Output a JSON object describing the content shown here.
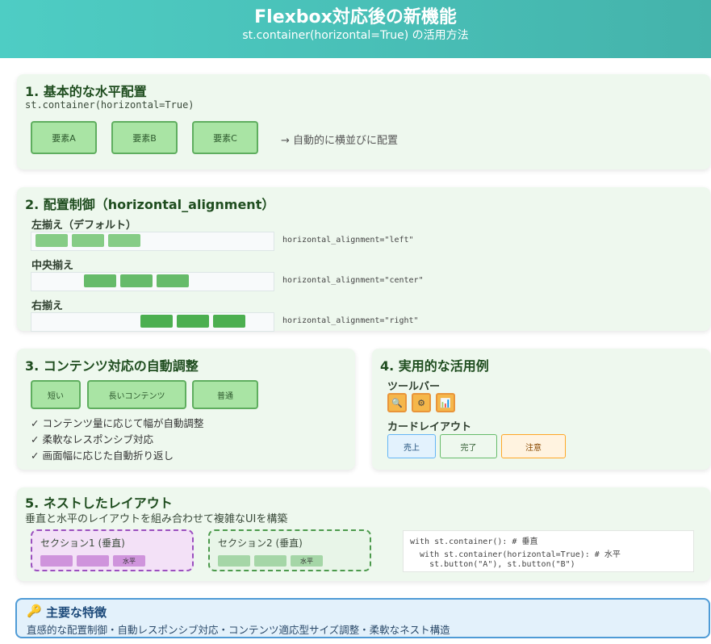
{
  "header": {
    "title": "Flexbox対応後の新機能",
    "subtitle": "st.container(horizontal=True) の活用方法"
  },
  "s1": {
    "title": "1. 基本的な水平配置",
    "code": "st.container(horizontal=True)",
    "boxes": [
      "要素A",
      "要素B",
      "要素C"
    ],
    "arrow_note": "→ 自動的に横並びに配置"
  },
  "s2": {
    "title": "2. 配置制御（horizontal_alignment）",
    "rows": [
      {
        "label": "左揃え（デフォルト）",
        "code": "horizontal_alignment=\"left\""
      },
      {
        "label": "中央揃え",
        "code": "horizontal_alignment=\"center\""
      },
      {
        "label": "右揃え",
        "code": "horizontal_alignment=\"right\""
      }
    ]
  },
  "s3": {
    "title": "3. コンテンツ対応の自動調整",
    "boxes": [
      "短い",
      "長いコンテンツ",
      "普通"
    ],
    "checks": [
      "✓ コンテンツ量に応じて幅が自動調整",
      "✓ 柔軟なレスポンシブ対応",
      "✓ 画面幅に応じた自動折り返し"
    ]
  },
  "s4": {
    "title": "4. 実用的な活用例",
    "toolbar_label": "ツールバー",
    "toolbar_icons": [
      "🔍",
      "⚙",
      "📊"
    ],
    "cards_label": "カードレイアウト",
    "cards": [
      "売上",
      "完了",
      "注意"
    ]
  },
  "s5": {
    "title": "5. ネストしたレイアウト",
    "desc": "垂直と水平のレイアウトを組み合わせて複雑なUIを構築",
    "sec1": {
      "title": "セクション1 (垂直)",
      "bar_label": "水平"
    },
    "sec2": {
      "title": "セクション2 (垂直)",
      "bar_label": "水平"
    },
    "code_lines": [
      "with st.container(): # 垂直",
      "  with st.container(horizontal=True): # 水平",
      "    st.button(\"A\"), st.button(\"B\")"
    ]
  },
  "features": {
    "icon": "🔑",
    "title": "主要な特徴",
    "text": "直感的な配置制御・自動レスポンシブ対応・コンテンツ適応型サイズ調整・柔軟なネスト構造"
  },
  "colors": {
    "header_start": "#4ecdc4",
    "header_end": "#44b3ab",
    "panel_bg": "#eef8ee",
    "green_box": "#a9e4a4",
    "purple": "#9b4fbf",
    "info_border": "#4f9bd6"
  }
}
